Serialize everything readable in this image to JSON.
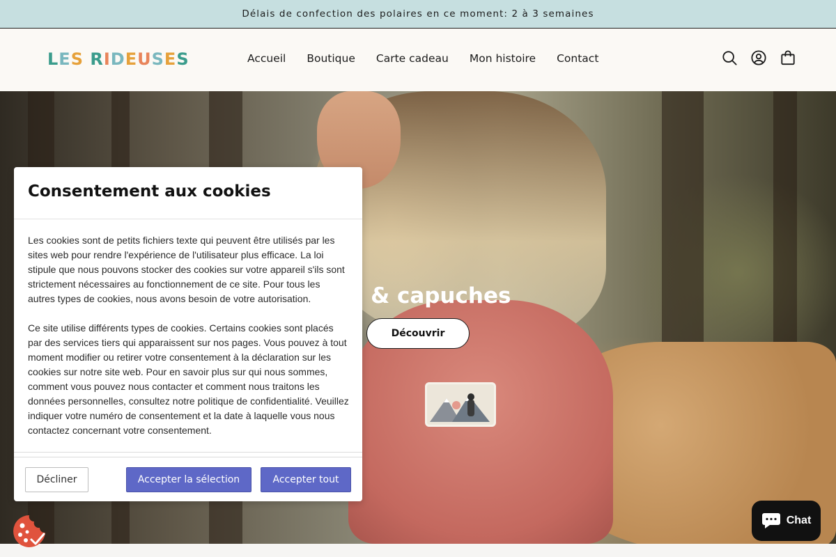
{
  "announcement": {
    "text": "Délais de confection des polaires en ce moment: 2 à 3 semaines"
  },
  "header": {
    "logo": {
      "letters": [
        {
          "char": "L",
          "color": "#3a9c8c"
        },
        {
          "char": "E",
          "color": "#79b7be"
        },
        {
          "char": "S",
          "color": "#e6a13a"
        },
        {
          "char": " ",
          "color": "#ffffff"
        },
        {
          "char": "R",
          "color": "#3a9c8c"
        },
        {
          "char": "I",
          "color": "#e8845a"
        },
        {
          "char": "D",
          "color": "#79b7be"
        },
        {
          "char": "E",
          "color": "#e6a13a"
        },
        {
          "char": "U",
          "color": "#e8845a"
        },
        {
          "char": "S",
          "color": "#79b7be"
        },
        {
          "char": "E",
          "color": "#e6a13a"
        },
        {
          "char": "S",
          "color": "#3a9c8c"
        }
      ]
    },
    "nav": [
      "Accueil",
      "Boutique",
      "Carte cadeau",
      "Mon histoire",
      "Contact"
    ],
    "icons": [
      "search-icon",
      "account-icon",
      "cart-icon"
    ]
  },
  "hero": {
    "title_visible": "res & capuches",
    "button": "Découvrir"
  },
  "cookie_banner": {
    "title": "Consentement aux cookies",
    "paragraphs": [
      "Les cookies sont de petits fichiers texte qui peuvent être utilisés par les sites web pour rendre l'expérience de l'utilisateur plus efficace. La loi stipule que nous pouvons stocker des cookies sur votre appareil s'ils sont strictement nécessaires au fonctionnement de ce site. Pour tous les autres types de cookies, nous avons besoin de votre autorisation.",
      "Ce site utilise différents types de cookies. Certains cookies sont placés par des services tiers qui apparaissent sur nos pages. Vous pouvez à tout moment modifier ou retirer votre consentement à la déclaration sur les cookies sur notre site web. Pour en savoir plus sur qui nous sommes, comment vous pouvez nous contacter et comment nous traitons les données personnelles, consultez notre politique de confidentialité. Veuillez indiquer votre numéro de consentement et la date à laquelle vous nous contactez concernant votre consentement."
    ],
    "buttons": {
      "decline": "Décliner",
      "accept_selection": "Accepter la sélection",
      "accept_all": "Accepter tout"
    },
    "accent_color": "#5e68c7"
  },
  "chat": {
    "label": "Chat",
    "icon": "chat-bubble-icon"
  },
  "cookie_fab": {
    "icon": "cookie-settings-icon",
    "color": "#e0533d"
  }
}
